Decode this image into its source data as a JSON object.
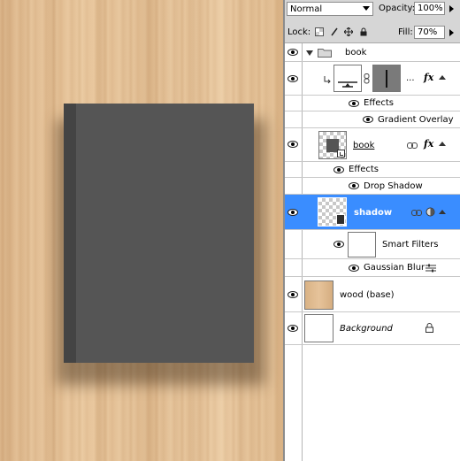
{
  "canvas": {
    "background": "wood texture",
    "book_color": "#555555",
    "spine_color": "#444444"
  },
  "panel": {
    "blend_mode": "Normal",
    "opacity_label": "Opacity:",
    "opacity_value": "100%",
    "lock_label": "Lock:",
    "fill_label": "Fill:",
    "fill_value": "70%"
  },
  "layers": {
    "group_name": "book",
    "gradient_effects_label": "Effects",
    "gradient_overlay": "Gradient Overlay",
    "book_layer": "book",
    "book_effects_label": "Effects",
    "drop_shadow": "Drop Shadow",
    "shadow_layer": "shadow",
    "smart_filters": "Smart Filters",
    "gaussian_blur": "Gaussian Blur",
    "wood_layer": "wood (base)",
    "background_layer": "Background",
    "fill_layer_name": "..."
  },
  "colors": {
    "selection": "#3a8dff",
    "panel_bg": "#d6d6d6"
  }
}
